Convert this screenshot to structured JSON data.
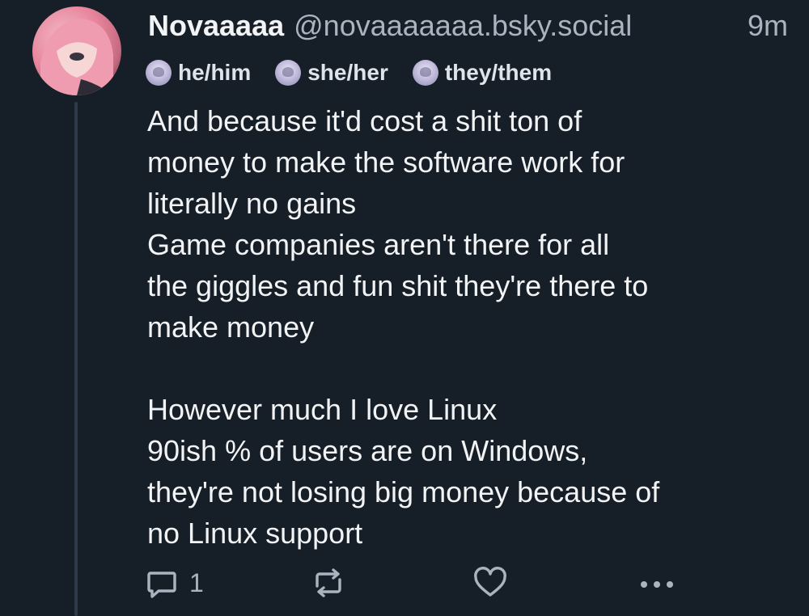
{
  "author": {
    "display_name": "Novaaaaa",
    "handle": "@novaaaaaaa.bsky.social",
    "time_ago": "9m"
  },
  "pronouns": [
    "he/him",
    "she/her",
    "they/them"
  ],
  "post": {
    "text": "And because it'd cost a shit ton of\nmoney to make the software work for\nliterally no gains\nGame companies aren't there for all\nthe giggles and fun shit they're there to\nmake money\n\nHowever much I love Linux\n90ish % of users are on Windows,\nthey're not losing big money because of\nno Linux support"
  },
  "actions": {
    "reply_count": "1",
    "icons": [
      "reply-icon",
      "repost-icon",
      "like-icon",
      "more-icon"
    ]
  },
  "colors": {
    "background": "#161e27",
    "text": "#f1f3f5",
    "muted": "#aab4c0",
    "thread_line": "#2e3a47"
  }
}
